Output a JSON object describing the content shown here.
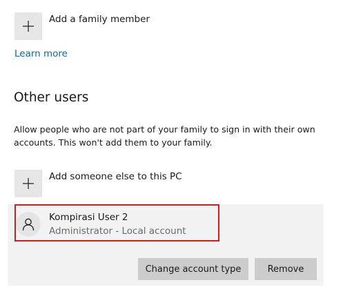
{
  "family": {
    "add_label": "Add a family member",
    "learn_more": "Learn more"
  },
  "other_users": {
    "title": "Other users",
    "description": "Allow people who are not part of your family to sign in with their own accounts. This won't add them to your family.",
    "add_label": "Add someone else to this PC",
    "user": {
      "name": "Kompirasi User 2",
      "role": "Administrator - Local account",
      "icon": "person-icon"
    },
    "buttons": {
      "change_type": "Change account type",
      "remove": "Remove"
    }
  },
  "colors": {
    "accent_link": "#0a66b3",
    "highlight_border": "#d01c23",
    "button_bg": "#cccccc",
    "panel_bg": "#f2f2f2",
    "tile_bg": "#e6e6e6"
  }
}
